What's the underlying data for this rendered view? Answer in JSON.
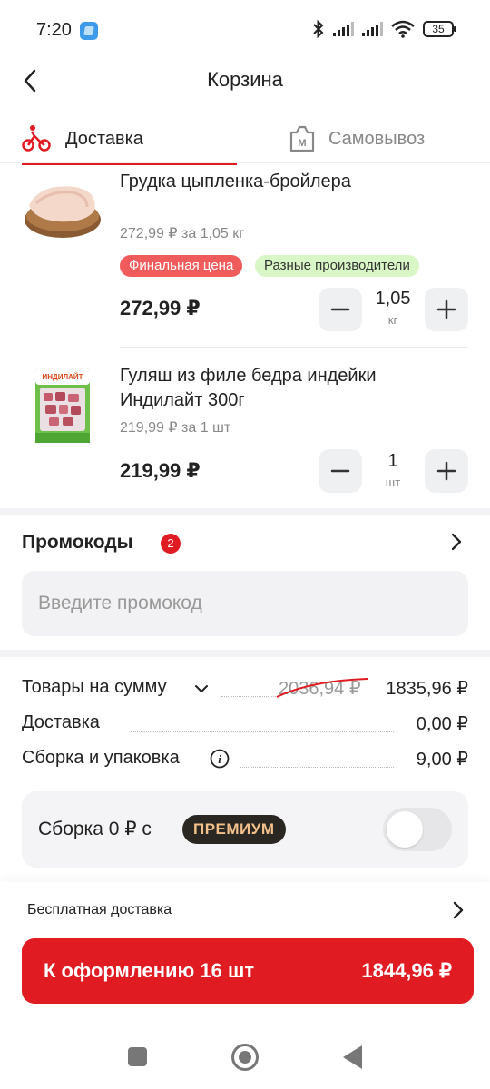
{
  "status_bar": {
    "time": "7:20",
    "battery": "35"
  },
  "header": {
    "title": "Корзина"
  },
  "tabs": [
    {
      "label": "Доставка",
      "active": true
    },
    {
      "label": "Самовывоз",
      "active": false
    }
  ],
  "products": [
    {
      "name": "Грудка цыпленка-бройлера",
      "unit_price": "272,99 ₽ за 1,05 кг",
      "badges": [
        "Финальная цена",
        "Разные производители"
      ],
      "price": "272,99 ₽",
      "quantity": "1,05",
      "quantity_unit": "кг"
    },
    {
      "name_line1": "Гуляш из филе бедра индейки",
      "name_line2": "Индилайт 300г",
      "unit_price": "219,99 ₽ за 1 шт",
      "price": "219,99 ₽",
      "quantity": "1",
      "quantity_unit": "шт",
      "package_brand": "ИНДИЛАЙТ"
    }
  ],
  "promo": {
    "title": "Промокоды",
    "count": "2",
    "placeholder": "Введите промокод"
  },
  "summary": {
    "goods_label": "Товары на сумму",
    "goods_old": "2036,94 ₽",
    "goods_value": "1835,96 ₽",
    "delivery_label": "Доставка",
    "delivery_value": "0,00 ₽",
    "packing_label": "Сборка и упаковка",
    "packing_value": "9,00 ₽"
  },
  "premium": {
    "text": "Сборка 0 ₽ с",
    "badge": "ПРЕМИУМ",
    "toggle_on": false
  },
  "bottom": {
    "free_delivery": "Бесплатная доставка",
    "checkout_label": "К оформлению 16 шт",
    "checkout_total": "1844,96 ₽"
  },
  "colors": {
    "accent": "#e01b22",
    "badge_red": "#f05b5b",
    "badge_green": "#d9f7c6",
    "premium_bg": "#2a2622",
    "premium_text": "#f2c08a"
  }
}
